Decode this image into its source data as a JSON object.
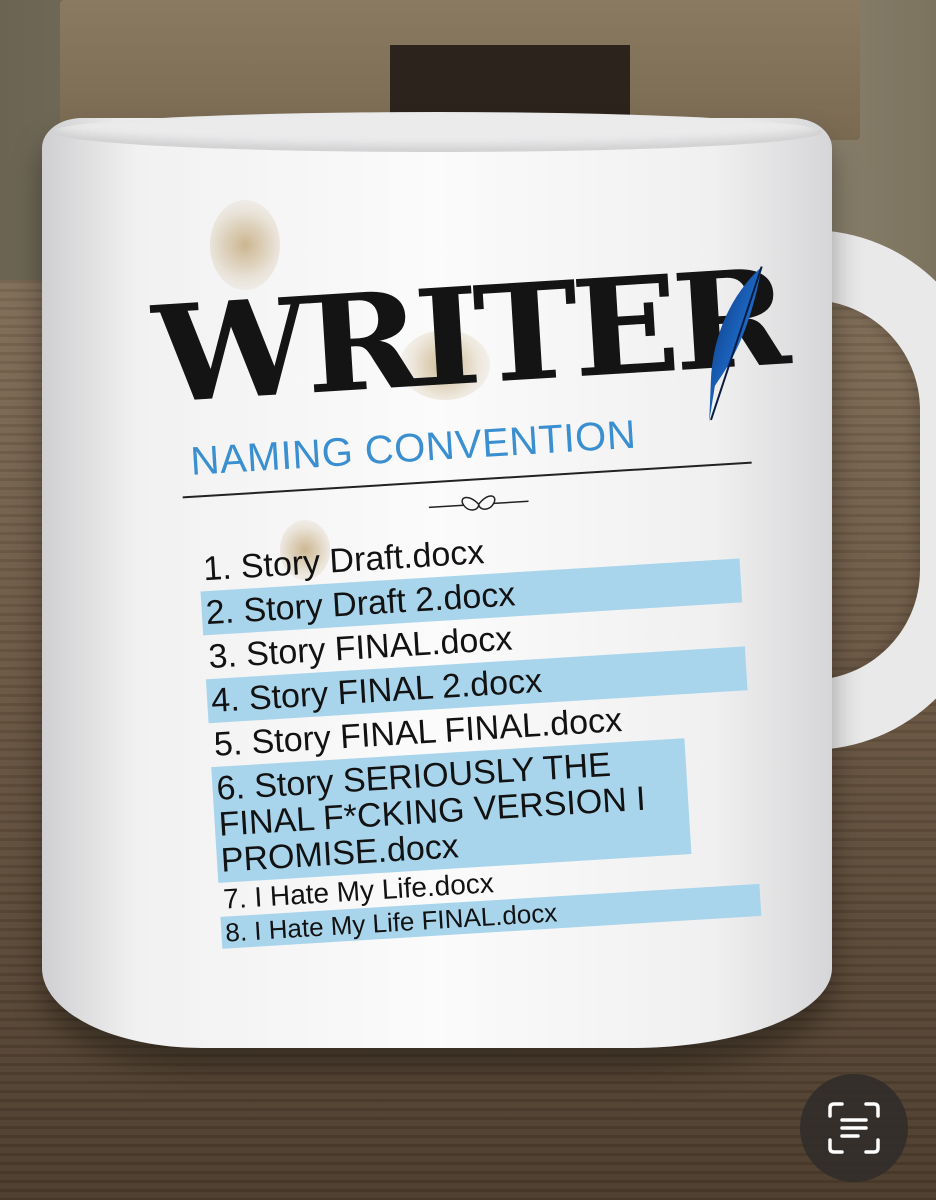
{
  "mug": {
    "title": "WRITER",
    "subtitle": "NAMING CONVENTION",
    "items": [
      "1. Story Draft.docx",
      "2. Story Draft 2.docx",
      "3. Story FINAL.docx",
      "4. Story FINAL 2.docx",
      "5. Story FINAL FINAL.docx",
      "6. Story SERIOUSLY THE FINAL F*CKING VERSION I PROMISE.docx",
      "7. I Hate My Life.docx",
      "8. I Hate My Life FINAL.docx"
    ]
  },
  "colors": {
    "accent": "#3a8fd0",
    "highlight": "#a9d5ec",
    "text": "#141414"
  },
  "icons": {
    "quill": "quill-feather-icon",
    "scan": "text-scan-icon"
  }
}
